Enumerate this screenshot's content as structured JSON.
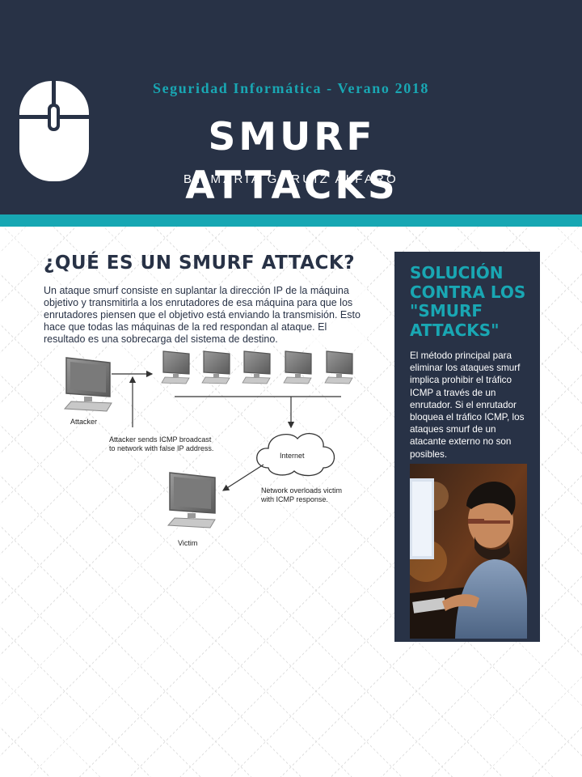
{
  "header": {
    "subtitle": "Seguridad Informática - Verano 2018",
    "title": "SMURF ATTACKS",
    "byline": "BY MARIA G. RUIZ ALFARO",
    "icon": "computer-mouse-icon",
    "colors": {
      "background": "#283246",
      "accent": "#17a7b3",
      "text": "#ffffff"
    }
  },
  "section": {
    "heading": "¿QUÉ ES UN SMURF ATTACK?",
    "body": "Un ataque smurf consiste en suplantar la dirección IP de la máquina objetivo y transmitirla a los enrutadores de esa máquina para que los enrutadores piensen que el objetivo está enviando la transmisión. Esto hace que todas las máquinas de la red respondan al ataque. El resultado es una sobrecarga del sistema de destino."
  },
  "diagram": {
    "attacker_label": "Attacker",
    "attacker_note_line1": "Attacker sends ICMP broadcast",
    "attacker_note_line2": "to network with false IP address.",
    "internet_label": "Internet",
    "victim_note_line1": "Network overloads victim",
    "victim_note_line2": "with ICMP response.",
    "victim_label": "Victim"
  },
  "sidebar": {
    "title": "SOLUCIÓN CONTRA LOS \"SMURF ATTACKS\"",
    "body": "El método principal para eliminar los ataques smurf implica prohibir el tráfico ICMP a través de un enrutador. Si el enrutador bloquea el tráfico ICMP, los ataques smurf de un atacante externo no son posibles."
  }
}
